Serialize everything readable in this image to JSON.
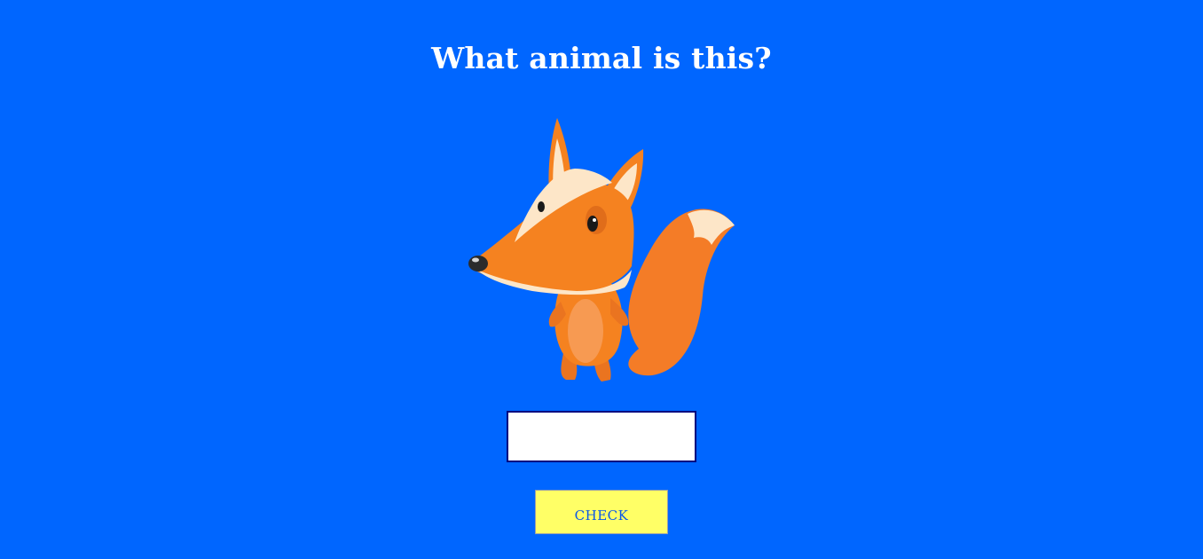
{
  "question": {
    "text": "What animal is this?"
  },
  "image": {
    "icon": "fox-illustration"
  },
  "answer": {
    "value": "",
    "placeholder": ""
  },
  "check_button": {
    "label": "check"
  },
  "colors": {
    "background": "#0066ff",
    "question_text": "#ffffff",
    "button_bg": "#ffff66",
    "button_text": "#0b57e8",
    "input_border": "#000080",
    "fox_orange": "#f58220",
    "fox_cream": "#fde6c8"
  }
}
